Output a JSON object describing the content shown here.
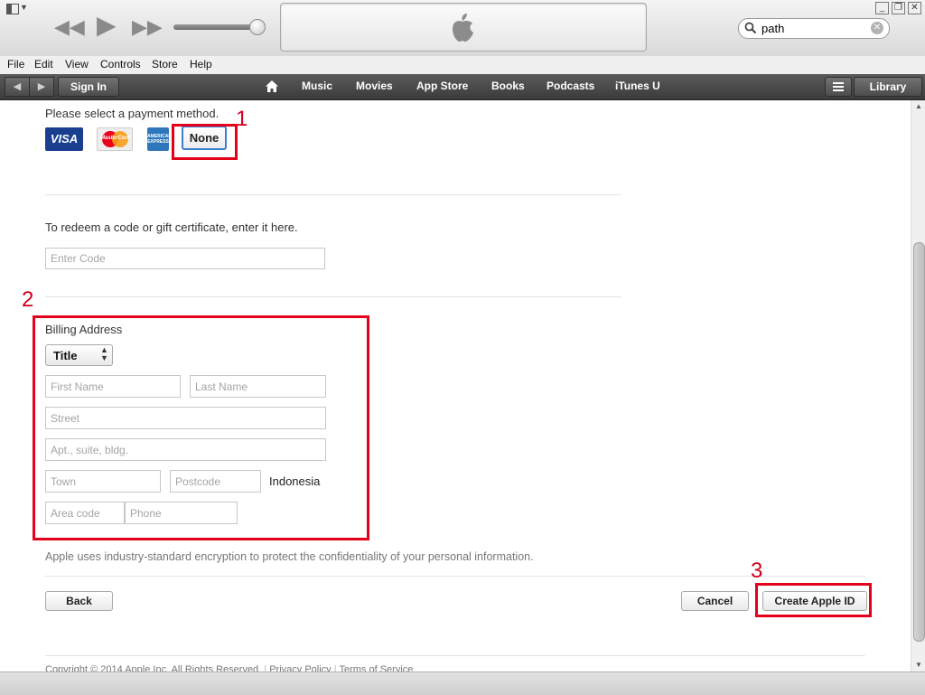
{
  "window": {
    "controls": [
      "_",
      "❐",
      "✕"
    ]
  },
  "player": {
    "icons": [
      "rewind-icon",
      "play-icon",
      "fast-forward-icon",
      "apple-logo-icon"
    ]
  },
  "search": {
    "value": "path"
  },
  "menu": {
    "items": [
      "File",
      "Edit",
      "View",
      "Controls",
      "Store",
      "Help"
    ]
  },
  "nav": {
    "sign_in": "Sign In",
    "links": [
      "Music",
      "Movies",
      "App Store",
      "Books",
      "Podcasts",
      "iTunes U"
    ],
    "library": "Library"
  },
  "payment": {
    "heading": "Please select a payment method.",
    "cards": [
      "VISA",
      "MasterCard",
      "AMERICAN EXPRESS"
    ],
    "none_label": "None"
  },
  "redeem": {
    "heading": "To redeem a code or gift certificate, enter it here.",
    "code_placeholder": "Enter Code"
  },
  "billing": {
    "heading": "Billing Address",
    "title_select": "Title",
    "first_name": "First Name",
    "last_name": "Last Name",
    "street": "Street",
    "apt": "Apt., suite, bldg.",
    "town": "Town",
    "postcode": "Postcode",
    "country": "Indonesia",
    "area_code": "Area code",
    "phone": "Phone"
  },
  "privacy_note": "Apple uses industry-standard encryption to protect the confidentiality of your personal information.",
  "buttons": {
    "back": "Back",
    "cancel": "Cancel",
    "create": "Create Apple ID"
  },
  "annotations": [
    "1",
    "2",
    "3"
  ],
  "footer": {
    "copyright": "Copyright © 2014 Apple Inc. All Rights Reserved.",
    "privacy": "Privacy Policy",
    "terms": "Terms of Service"
  },
  "colors": {
    "annotation_red": "#e3001b",
    "visa_blue": "#1a3f8f",
    "none_border": "#3d7fd1"
  }
}
